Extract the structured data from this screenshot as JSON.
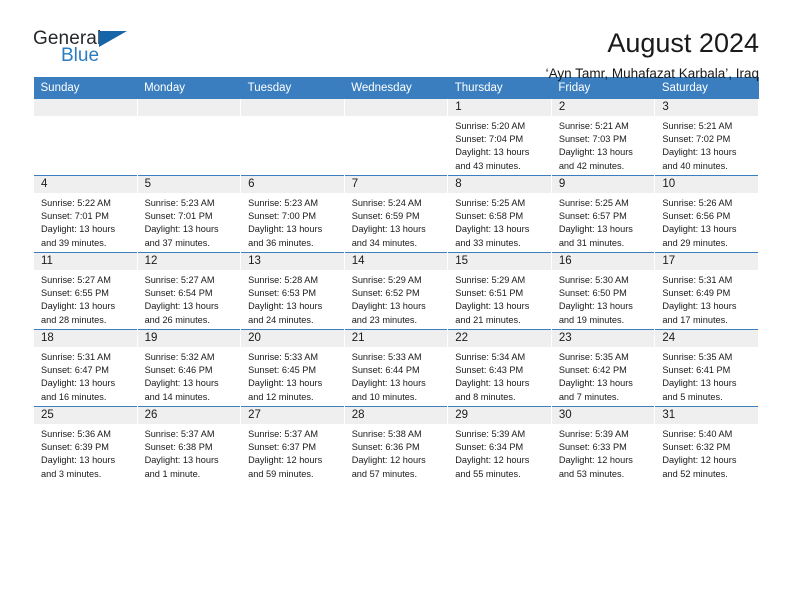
{
  "brand": {
    "word_general": "General",
    "word_blue": "Blue",
    "logo_icon": "triangle-flag-icon"
  },
  "header": {
    "title": "August 2024",
    "subtitle": "‘Ayn Tamr, Muhafazat Karbala’, Iraq"
  },
  "colors": {
    "header_blue": "#3a7ebf",
    "brand_blue": "#2b7cc0",
    "daynum_gray": "#efefef",
    "text": "#1a1a1a"
  },
  "calendar": {
    "weekday_headers": [
      "Sunday",
      "Monday",
      "Tuesday",
      "Wednesday",
      "Thursday",
      "Friday",
      "Saturday"
    ],
    "weeks": [
      [
        {
          "day": "",
          "lines": []
        },
        {
          "day": "",
          "lines": []
        },
        {
          "day": "",
          "lines": []
        },
        {
          "day": "",
          "lines": []
        },
        {
          "day": "1",
          "lines": [
            "Sunrise: 5:20 AM",
            "Sunset: 7:04 PM",
            "Daylight: 13 hours",
            "and 43 minutes."
          ]
        },
        {
          "day": "2",
          "lines": [
            "Sunrise: 5:21 AM",
            "Sunset: 7:03 PM",
            "Daylight: 13 hours",
            "and 42 minutes."
          ]
        },
        {
          "day": "3",
          "lines": [
            "Sunrise: 5:21 AM",
            "Sunset: 7:02 PM",
            "Daylight: 13 hours",
            "and 40 minutes."
          ]
        }
      ],
      [
        {
          "day": "4",
          "lines": [
            "Sunrise: 5:22 AM",
            "Sunset: 7:01 PM",
            "Daylight: 13 hours",
            "and 39 minutes."
          ]
        },
        {
          "day": "5",
          "lines": [
            "Sunrise: 5:23 AM",
            "Sunset: 7:01 PM",
            "Daylight: 13 hours",
            "and 37 minutes."
          ]
        },
        {
          "day": "6",
          "lines": [
            "Sunrise: 5:23 AM",
            "Sunset: 7:00 PM",
            "Daylight: 13 hours",
            "and 36 minutes."
          ]
        },
        {
          "day": "7",
          "lines": [
            "Sunrise: 5:24 AM",
            "Sunset: 6:59 PM",
            "Daylight: 13 hours",
            "and 34 minutes."
          ]
        },
        {
          "day": "8",
          "lines": [
            "Sunrise: 5:25 AM",
            "Sunset: 6:58 PM",
            "Daylight: 13 hours",
            "and 33 minutes."
          ]
        },
        {
          "day": "9",
          "lines": [
            "Sunrise: 5:25 AM",
            "Sunset: 6:57 PM",
            "Daylight: 13 hours",
            "and 31 minutes."
          ]
        },
        {
          "day": "10",
          "lines": [
            "Sunrise: 5:26 AM",
            "Sunset: 6:56 PM",
            "Daylight: 13 hours",
            "and 29 minutes."
          ]
        }
      ],
      [
        {
          "day": "11",
          "lines": [
            "Sunrise: 5:27 AM",
            "Sunset: 6:55 PM",
            "Daylight: 13 hours",
            "and 28 minutes."
          ]
        },
        {
          "day": "12",
          "lines": [
            "Sunrise: 5:27 AM",
            "Sunset: 6:54 PM",
            "Daylight: 13 hours",
            "and 26 minutes."
          ]
        },
        {
          "day": "13",
          "lines": [
            "Sunrise: 5:28 AM",
            "Sunset: 6:53 PM",
            "Daylight: 13 hours",
            "and 24 minutes."
          ]
        },
        {
          "day": "14",
          "lines": [
            "Sunrise: 5:29 AM",
            "Sunset: 6:52 PM",
            "Daylight: 13 hours",
            "and 23 minutes."
          ]
        },
        {
          "day": "15",
          "lines": [
            "Sunrise: 5:29 AM",
            "Sunset: 6:51 PM",
            "Daylight: 13 hours",
            "and 21 minutes."
          ]
        },
        {
          "day": "16",
          "lines": [
            "Sunrise: 5:30 AM",
            "Sunset: 6:50 PM",
            "Daylight: 13 hours",
            "and 19 minutes."
          ]
        },
        {
          "day": "17",
          "lines": [
            "Sunrise: 5:31 AM",
            "Sunset: 6:49 PM",
            "Daylight: 13 hours",
            "and 17 minutes."
          ]
        }
      ],
      [
        {
          "day": "18",
          "lines": [
            "Sunrise: 5:31 AM",
            "Sunset: 6:47 PM",
            "Daylight: 13 hours",
            "and 16 minutes."
          ]
        },
        {
          "day": "19",
          "lines": [
            "Sunrise: 5:32 AM",
            "Sunset: 6:46 PM",
            "Daylight: 13 hours",
            "and 14 minutes."
          ]
        },
        {
          "day": "20",
          "lines": [
            "Sunrise: 5:33 AM",
            "Sunset: 6:45 PM",
            "Daylight: 13 hours",
            "and 12 minutes."
          ]
        },
        {
          "day": "21",
          "lines": [
            "Sunrise: 5:33 AM",
            "Sunset: 6:44 PM",
            "Daylight: 13 hours",
            "and 10 minutes."
          ]
        },
        {
          "day": "22",
          "lines": [
            "Sunrise: 5:34 AM",
            "Sunset: 6:43 PM",
            "Daylight: 13 hours",
            "and 8 minutes."
          ]
        },
        {
          "day": "23",
          "lines": [
            "Sunrise: 5:35 AM",
            "Sunset: 6:42 PM",
            "Daylight: 13 hours",
            "and 7 minutes."
          ]
        },
        {
          "day": "24",
          "lines": [
            "Sunrise: 5:35 AM",
            "Sunset: 6:41 PM",
            "Daylight: 13 hours",
            "and 5 minutes."
          ]
        }
      ],
      [
        {
          "day": "25",
          "lines": [
            "Sunrise: 5:36 AM",
            "Sunset: 6:39 PM",
            "Daylight: 13 hours",
            "and 3 minutes."
          ]
        },
        {
          "day": "26",
          "lines": [
            "Sunrise: 5:37 AM",
            "Sunset: 6:38 PM",
            "Daylight: 13 hours",
            "and 1 minute."
          ]
        },
        {
          "day": "27",
          "lines": [
            "Sunrise: 5:37 AM",
            "Sunset: 6:37 PM",
            "Daylight: 12 hours",
            "and 59 minutes."
          ]
        },
        {
          "day": "28",
          "lines": [
            "Sunrise: 5:38 AM",
            "Sunset: 6:36 PM",
            "Daylight: 12 hours",
            "and 57 minutes."
          ]
        },
        {
          "day": "29",
          "lines": [
            "Sunrise: 5:39 AM",
            "Sunset: 6:34 PM",
            "Daylight: 12 hours",
            "and 55 minutes."
          ]
        },
        {
          "day": "30",
          "lines": [
            "Sunrise: 5:39 AM",
            "Sunset: 6:33 PM",
            "Daylight: 12 hours",
            "and 53 minutes."
          ]
        },
        {
          "day": "31",
          "lines": [
            "Sunrise: 5:40 AM",
            "Sunset: 6:32 PM",
            "Daylight: 12 hours",
            "and 52 minutes."
          ]
        }
      ]
    ]
  }
}
